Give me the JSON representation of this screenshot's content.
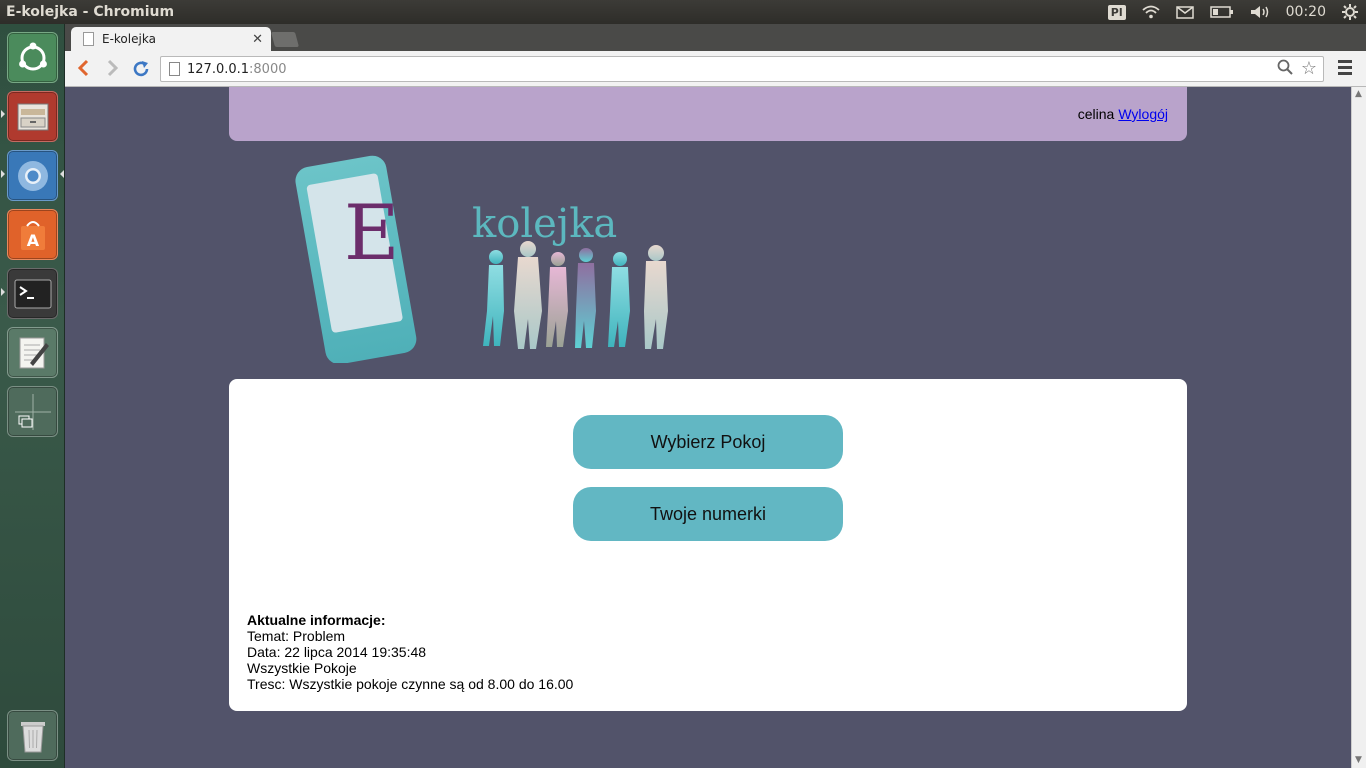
{
  "window": {
    "title": "E-kolejka - Chromium"
  },
  "tray": {
    "keyboard": "Pl",
    "clock": "00:20"
  },
  "browser": {
    "tab_title": "E-kolejka",
    "url_host": "127.0.0.1",
    "url_port": ":8000"
  },
  "header": {
    "username": "celina",
    "logout_label": "Wylogój"
  },
  "logo": {
    "letter": "E",
    "word": "kolejka"
  },
  "menu": {
    "choose_room": "Wybierz Pokoj",
    "my_numbers": "Twoje numerki"
  },
  "info": {
    "heading": "Aktualne informacje:",
    "topic": "Temat: Problem",
    "date": "Data: 22 lipca 2014 19:35:48",
    "rooms": "Wszystkie Pokoje",
    "content": "Tresc: Wszystkie pokoje czynne są od 8.00 do 16.00"
  },
  "colors": {
    "page_bg": "#52536a",
    "header_bg": "#b9a3cb",
    "button_bg": "#62b7c3",
    "logo_teal": "#5cb8bf",
    "logo_purple": "#6b2d6b"
  }
}
